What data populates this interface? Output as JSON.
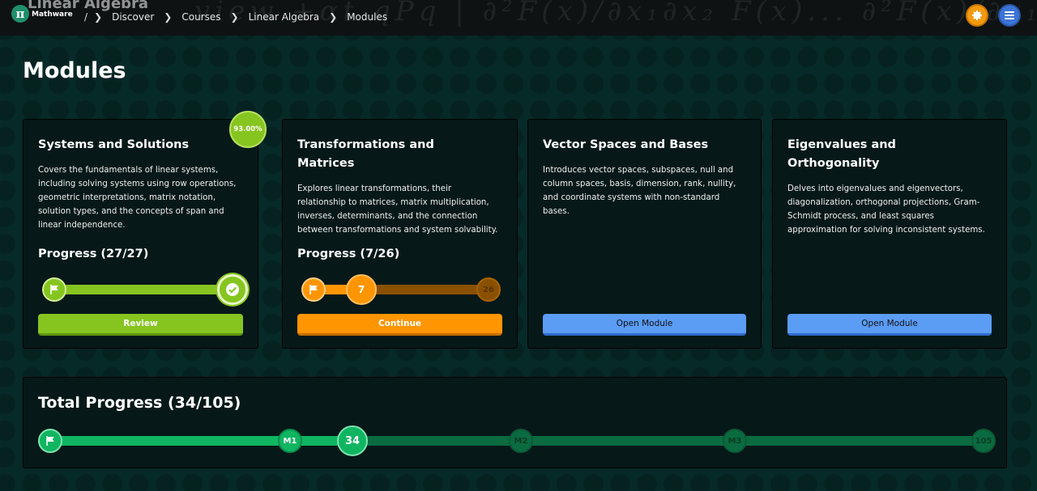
{
  "topbar": {
    "course_ghost": "Linear Algebra",
    "math_deco": "view  +αt qPq   | ∂²F(x)/∂x₁∂x₂  F(x)...  ∂²F(x)/∂x₁∂xₙ",
    "logo_text": "Mathware",
    "breadcrumb": [
      "Discover",
      "Courses",
      "Linear Algebra",
      "Modules"
    ],
    "icons": [
      "gear-icon",
      "menu-icon"
    ]
  },
  "page": {
    "title": "Modules"
  },
  "modules": [
    {
      "title": "Systems and Solutions",
      "description": "Covers the fundamentals of linear systems, including solving systems using row operations, geometric interpretations, matrix notation, solution types, and the concepts of span and linear independence.",
      "badge": "93.00%",
      "progress_label": "Progress (27/27)",
      "progress": {
        "done": 27,
        "total": 27
      },
      "button": "Review"
    },
    {
      "title": "Transformations and Matrices",
      "description": "Explores linear transformations, their relationship to matrices, matrix multiplication, inverses, determinants, and the connection between transformations and system solvability.",
      "progress_label": "Progress (7/26)",
      "progress": {
        "done": 7,
        "total": 26
      },
      "current_label": "7",
      "end_label": "26",
      "button": "Continue"
    },
    {
      "title": "Vector Spaces and Bases",
      "description": "Introduces vector spaces, subspaces, null and column spaces, basis, dimension, rank, nullity, and coordinate systems with non-standard bases.",
      "button": "Open Module"
    },
    {
      "title": "Eigenvalues and Orthogonality",
      "description": "Delves into eigenvalues and eigenvectors, diagonalization, orthogonal projections, Gram-Schmidt process, and least squares approximation for solving inconsistent systems.",
      "button": "Open Module"
    }
  ],
  "total": {
    "title": "Total Progress (34/105)",
    "done": 34,
    "total": 105,
    "current_label": "34",
    "milestones": [
      "M1",
      "M2",
      "M3"
    ],
    "end_label": "105"
  },
  "colors": {
    "green_done": "#86c520",
    "orange_active": "#ff9500",
    "blue_open": "#5b9cf5",
    "total_green": "#0fb561"
  }
}
